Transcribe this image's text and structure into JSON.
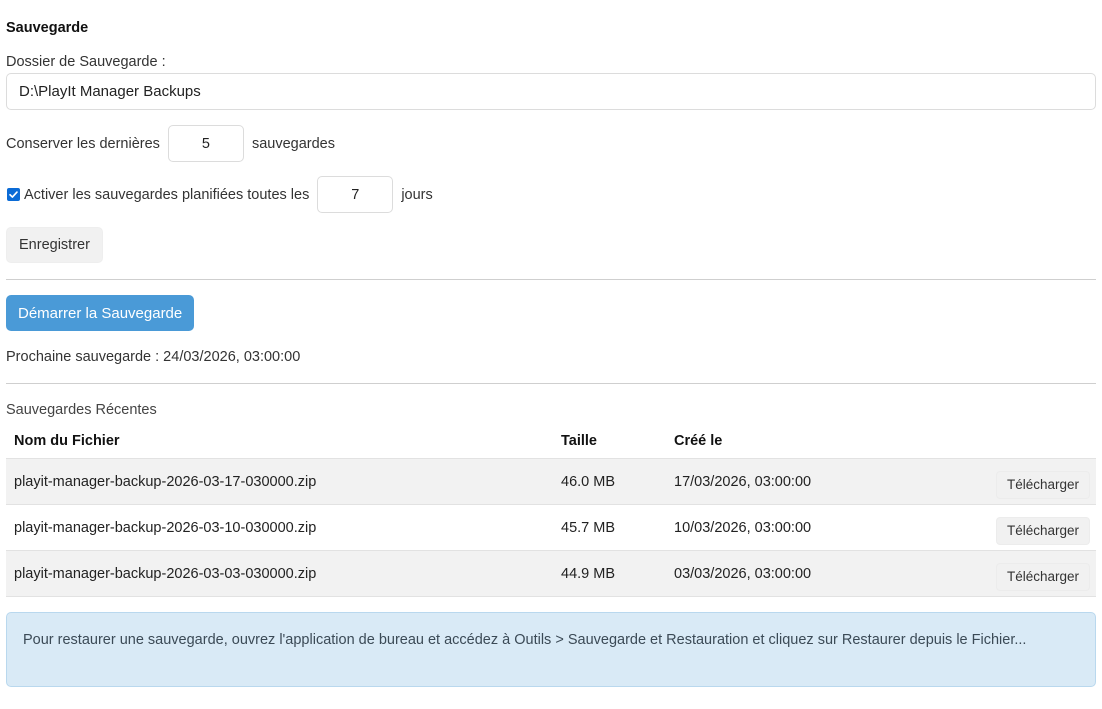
{
  "section_title": "Sauvegarde",
  "folder": {
    "label": "Dossier de Sauvegarde :",
    "value": "D:\\PlayIt Manager Backups"
  },
  "keep": {
    "prefix": "Conserver les dernières",
    "value": "5",
    "suffix": "sauvegardes"
  },
  "schedule": {
    "checked": true,
    "prefix": "Activer les sauvegardes planifiées toutes les",
    "value": "7",
    "suffix": "jours"
  },
  "save_button": "Enregistrer",
  "start_button": "Démarrer la Sauvegarde",
  "next_backup": "Prochaine sauvegarde : 24/03/2026, 03:00:00",
  "recent": {
    "title": "Sauvegardes Récentes",
    "columns": [
      "Nom du Fichier",
      "Taille",
      "Créé le",
      ""
    ],
    "rows": [
      {
        "name": "playit-manager-backup-2026-03-17-030000.zip",
        "size": "46.0 MB",
        "created": "17/03/2026, 03:00:00",
        "action": "Télécharger"
      },
      {
        "name": "playit-manager-backup-2026-03-10-030000.zip",
        "size": "45.7 MB",
        "created": "10/03/2026, 03:00:00",
        "action": "Télécharger"
      },
      {
        "name": "playit-manager-backup-2026-03-03-030000.zip",
        "size": "44.9 MB",
        "created": "03/03/2026, 03:00:00",
        "action": "Télécharger"
      }
    ]
  },
  "info_text": "Pour restaurer une sauvegarde, ouvrez l'application de bureau et accédez à Outils > Sauvegarde et Restauration et cliquez sur Restaurer depuis le Fichier...",
  "colors": {
    "primary_button": "#4a9ad7",
    "info_background": "#d9eaf6",
    "checkbox": "#0b6bd6"
  }
}
